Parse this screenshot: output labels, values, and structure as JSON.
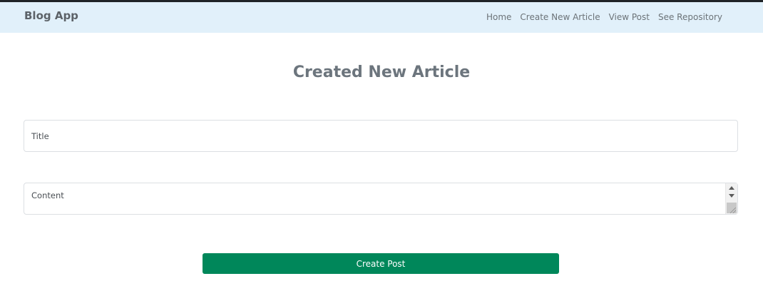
{
  "navbar": {
    "brand": "Blog App",
    "links": [
      "Home",
      "Create New Article",
      "View Post",
      "See Repository"
    ]
  },
  "page": {
    "title": "Created New Article"
  },
  "form": {
    "title_placeholder": "Title",
    "title_value": "",
    "content_placeholder": "Content",
    "content_value": "",
    "submit_label": "Create Post"
  },
  "icons": {
    "scroll_up": "triangle-up-icon",
    "scroll_down": "triangle-down-icon",
    "resize": "resize-grip-icon"
  },
  "colors": {
    "navbar_bg": "#e1f0fa",
    "button_bg": "#00875a",
    "button_text": "#ffffff",
    "title_text": "#6c757d"
  }
}
